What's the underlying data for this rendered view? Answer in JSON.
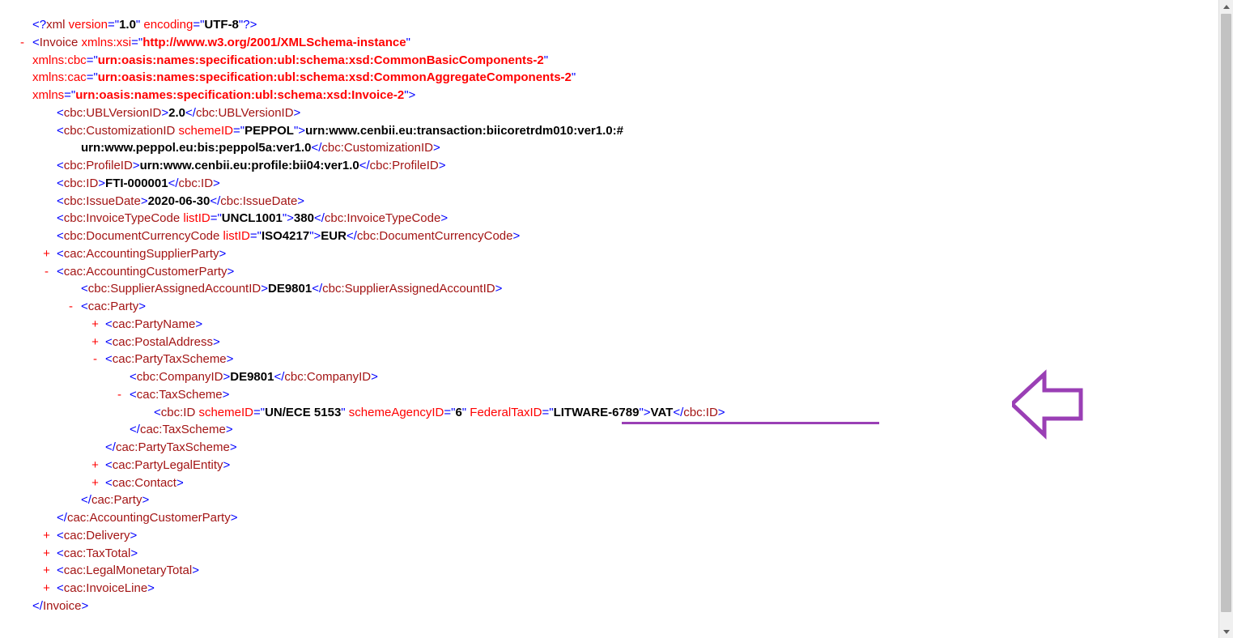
{
  "xml_declaration": {
    "version": "1.0",
    "encoding": "UTF-8"
  },
  "root": {
    "name": "Invoice",
    "namespaces": {
      "xsi": "http://www.w3.org/2001/XMLSchema-instance",
      "cbc": "urn:oasis:names:specification:ubl:schema:xsd:CommonBasicComponents-2",
      "cac": "urn:oasis:names:specification:ubl:schema:xsd:CommonAggregateComponents-2",
      "default": "urn:oasis:names:specification:ubl:schema:xsd:Invoice-2"
    }
  },
  "ublVersionID": "2.0",
  "customizationID": {
    "scheme": "PEPPOL",
    "value": "urn:www.cenbii.eu:transaction:biicoretrdm010:ver1.0:#",
    "value2": "urn:www.peppol.eu:bis:peppol5a:ver1.0"
  },
  "profileID": "urn:www.cenbii.eu:profile:bii04:ver1.0",
  "id": "FTI-000001",
  "issueDate": "2020-06-30",
  "invoiceTypeCode": {
    "listID": "UNCL1001",
    "value": "380"
  },
  "documentCurrencyCode": {
    "listID": "ISO4217",
    "value": "EUR"
  },
  "customerParty": {
    "supplierAssignedAccountID": "DE9801",
    "party": {
      "partyTaxScheme": {
        "companyID": "DE9801",
        "taxScheme": {
          "id": {
            "schemeID": "UN/ECE 5153",
            "schemeAgencyID": "6",
            "federalTaxID_attr": "FederalTaxID",
            "federalTaxID_val": "LITWARE-6789",
            "value": "VAT"
          }
        }
      }
    }
  },
  "collapsed": {
    "accountingSupplierParty": "cac:AccountingSupplierParty",
    "partyName": "cac:PartyName",
    "postalAddress": "cac:PostalAddress",
    "partyLegalEntity": "cac:PartyLegalEntity",
    "contact": "cac:Contact",
    "delivery": "cac:Delivery",
    "taxTotal": "cac:TaxTotal",
    "legalMonetaryTotal": "cac:LegalMonetaryTotal",
    "invoiceLine": "cac:InvoiceLine"
  }
}
